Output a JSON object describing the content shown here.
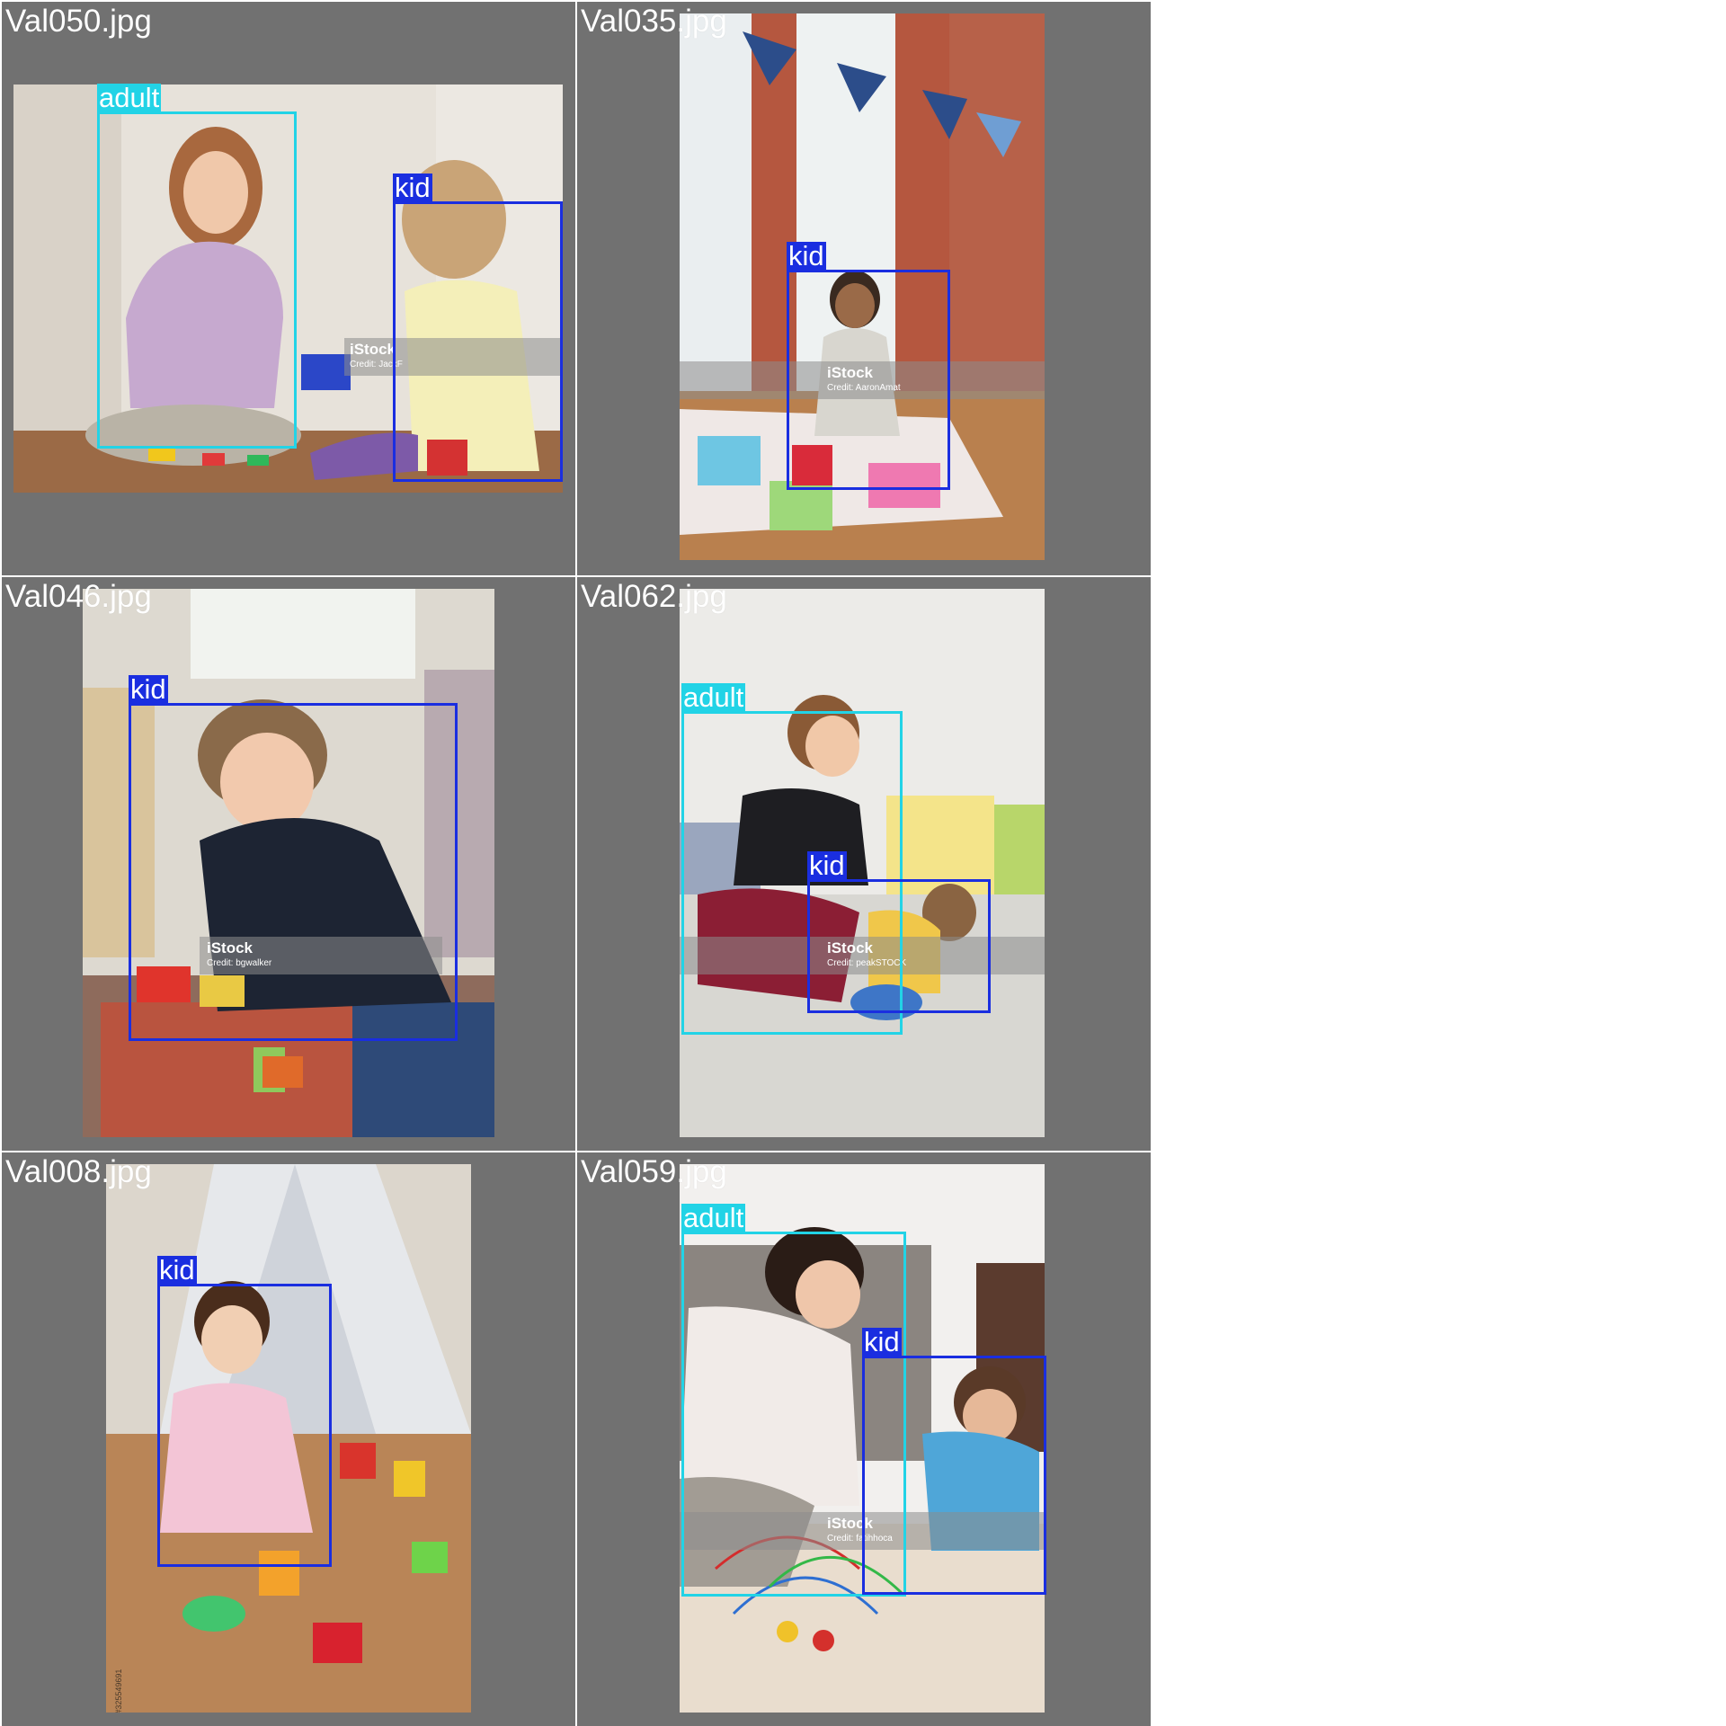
{
  "colors": {
    "tile_background": "#717171",
    "adult_box": "#22d3e6",
    "kid_box": "#1a2ee0"
  },
  "tiles": [
    {
      "filename": "Val050.jpg",
      "labels": [
        "adult",
        "kid"
      ],
      "watermark": {
        "brand": "iStock",
        "credit": "Credit: JackF"
      }
    },
    {
      "filename": "Val035.jpg",
      "labels": [
        "kid"
      ],
      "watermark": {
        "brand": "iStock",
        "credit": "Credit: AaronAmat"
      }
    },
    {
      "filename": "Val046.jpg",
      "labels": [
        "kid"
      ],
      "watermark": {
        "brand": "iStock",
        "credit": "Credit: bgwalker"
      }
    },
    {
      "filename": "Val062.jpg",
      "labels": [
        "adult",
        "kid"
      ],
      "watermark": {
        "brand": "iStock",
        "credit": "Credit: peakSTOCK"
      }
    },
    {
      "filename": "Val008.jpg",
      "labels": [
        "kid"
      ],
      "watermark": {
        "brand": "Adobe Stock | #325549691",
        "credit": ""
      }
    },
    {
      "filename": "Val059.jpg",
      "labels": [
        "adult",
        "kid"
      ],
      "watermark": {
        "brand": "iStock",
        "credit": "Credit: fatihhoca"
      }
    }
  ]
}
